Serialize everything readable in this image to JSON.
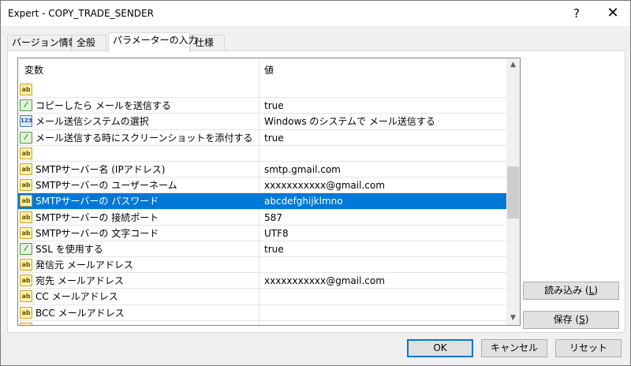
{
  "window": {
    "title": "Expert - COPY_TRADE_SENDER",
    "help_label": "?",
    "close_label": "✕"
  },
  "tabs": [
    {
      "label": "バージョン情報",
      "active": false
    },
    {
      "label": "全般",
      "active": false
    },
    {
      "label": "パラメーターの入力",
      "active": true
    },
    {
      "label": "仕様",
      "active": false
    }
  ],
  "grid": {
    "columns": {
      "name": "変数",
      "value": "値"
    },
    "rows": [
      {
        "icon": "ab",
        "name": "",
        "value": ""
      },
      {
        "icon": "bool",
        "name": "コピーしたら メールを送信する",
        "value": "true"
      },
      {
        "icon": "num",
        "name": "メール送信システムの選択",
        "value": "Windows のシステムで メール送信する"
      },
      {
        "icon": "bool",
        "name": "メール送信する時にスクリーンショットを添付する",
        "value": "true"
      },
      {
        "icon": "ab",
        "name": "",
        "value": ""
      },
      {
        "icon": "ab",
        "name": "SMTPサーバー名 (IPアドレス)",
        "value": "smtp.gmail.com"
      },
      {
        "icon": "ab",
        "name": "SMTPサーバーの ユーザーネーム",
        "value": "xxxxxxxxxxx@gmail.com"
      },
      {
        "icon": "ab",
        "name": "SMTPサーバーの パスワード",
        "value": "abcdefghijklmno",
        "selected": true
      },
      {
        "icon": "ab",
        "name": "SMTPサーバーの 接続ポート",
        "value": "587"
      },
      {
        "icon": "ab",
        "name": "SMTPサーバーの 文字コード",
        "value": "UTF8"
      },
      {
        "icon": "bool",
        "name": "SSL を使用する",
        "value": "true"
      },
      {
        "icon": "ab",
        "name": "発信元 メールアドレス",
        "value": ""
      },
      {
        "icon": "ab",
        "name": "宛先 メールアドレス",
        "value": "xxxxxxxxxxx@gmail.com"
      },
      {
        "icon": "ab",
        "name": "CC メールアドレス",
        "value": ""
      },
      {
        "icon": "ab",
        "name": "BCC メールアドレス",
        "value": ""
      },
      {
        "icon": "ab",
        "name": "",
        "value": ""
      }
    ]
  },
  "icons": {
    "ab": "ab",
    "bool": "⁄",
    "num": "123"
  },
  "buttons": {
    "load": {
      "text": "読み込み (",
      "key": "L",
      "end": ")"
    },
    "save": {
      "text": "保存 (",
      "key": "S",
      "end": ")"
    },
    "ok": "OK",
    "cancel": "キャンセル",
    "reset": "リセット"
  },
  "colors": {
    "selection": "#0078d7",
    "window_bg": "#f0f0f0"
  }
}
